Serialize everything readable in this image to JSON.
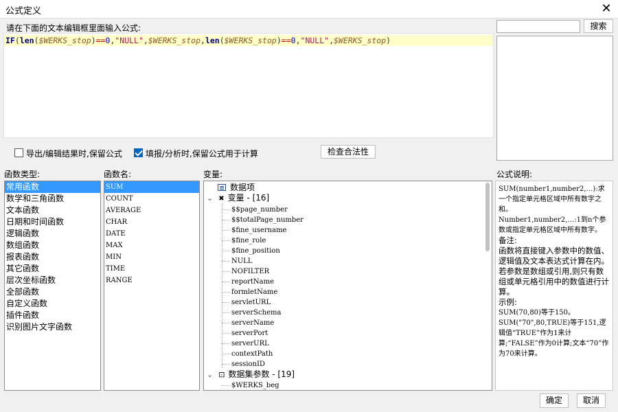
{
  "window": {
    "title": "公式定义",
    "close_glyph": "✕"
  },
  "prompt": "请在下面的文本编辑框里面输入公式:",
  "formula_tokens": [
    {
      "t": "IF",
      "c": "kw"
    },
    {
      "t": "(",
      "c": "pn"
    },
    {
      "t": "len",
      "c": "kw"
    },
    {
      "t": "(",
      "c": "pn"
    },
    {
      "t": "$WERKS_stop",
      "c": "vr"
    },
    {
      "t": ")",
      "c": "pn"
    },
    {
      "t": "==",
      "c": "op"
    },
    {
      "t": "0",
      "c": "nm"
    },
    {
      "t": ",",
      "c": "pn"
    },
    {
      "t": "\"NULL\"",
      "c": "st"
    },
    {
      "t": ",",
      "c": "pn"
    },
    {
      "t": "$WERKS_stop",
      "c": "vr"
    },
    {
      "t": ",",
      "c": "pn"
    },
    {
      "t": "len",
      "c": "kw"
    },
    {
      "t": "(",
      "c": "pn"
    },
    {
      "t": "$WERKS_stop",
      "c": "vr"
    },
    {
      "t": ")",
      "c": "pn"
    },
    {
      "t": "==",
      "c": "op"
    },
    {
      "t": "0",
      "c": "nm"
    },
    {
      "t": ",",
      "c": "pn"
    },
    {
      "t": "\"NULL\"",
      "c": "st"
    },
    {
      "t": ",",
      "c": "pn"
    },
    {
      "t": "$WERKS_stop",
      "c": "vr"
    },
    {
      "t": ")",
      "c": "pn"
    }
  ],
  "search": {
    "button_label": "搜索",
    "value": ""
  },
  "options": {
    "keep_on_export": {
      "label": "导出/编辑结果时,保留公式",
      "checked": false
    },
    "keep_for_calc": {
      "label": "填报/分析时,保留公式用于计算",
      "checked": true
    }
  },
  "check_button": "检查合法性",
  "labels": {
    "func_type": "函数类型:",
    "func_name": "函数名:",
    "variables": "变量:",
    "description": "公式说明:"
  },
  "func_types": [
    "常用函数",
    "数学和三角函数",
    "文本函数",
    "日期和时间函数",
    "逻辑函数",
    "数组函数",
    "报表函数",
    "其它函数",
    "层次坐标函数",
    "全部函数",
    "自定义函数",
    "插件函数",
    "识别图片文字函数"
  ],
  "func_types_selected": 0,
  "func_names": [
    "SUM",
    "COUNT",
    "AVERAGE",
    "CHAR",
    "DATE",
    "MAX",
    "MIN",
    "TIME",
    "RANGE"
  ],
  "func_names_selected": 0,
  "tree": {
    "data_item": "数据项",
    "variables_group": "变量 - [16]",
    "variables": [
      "$$page_number",
      "$$totalPage_number",
      "$fine_username",
      "$fine_role",
      "$fine_position",
      "NULL",
      "NOFILTER",
      "reportName",
      "formletName",
      "servletURL",
      "serverSchema",
      "serverName",
      "serverPort",
      "serverURL",
      "contextPath",
      "sessionID"
    ],
    "dataset_group": "数据集参数 - [19]",
    "dataset_params": [
      "$WERKS_beg"
    ]
  },
  "description": [
    {
      "t": "SUM(number1,number2,…):求一个指定单元格区域中所有数字之和。",
      "serif": true
    },
    {
      "t": "Number1,number2,…:1到n个参数或指定单元格区域中所有数字。",
      "serif": true
    },
    {
      "t": "备注:",
      "serif": false
    },
    {
      "t": "函数将直接键入参数中的数值、逻辑值及文本表达式计算在内。若参数是数组或引用,则只有数组或单元格引用中的数值进行计算。",
      "serif": false
    },
    {
      "t": "示例:",
      "serif": false
    },
    {
      "t": "SUM(70,80)等于150。",
      "serif": true
    },
    {
      "t": "SUM(\"70\",80,TRUE)等于151,逻辑值“TRUE”作为1来计算;“FALSE”作为0计算;文本“70”作为70来计算。",
      "serif": true
    }
  ],
  "buttons": {
    "ok": "确定",
    "cancel": "取消"
  }
}
